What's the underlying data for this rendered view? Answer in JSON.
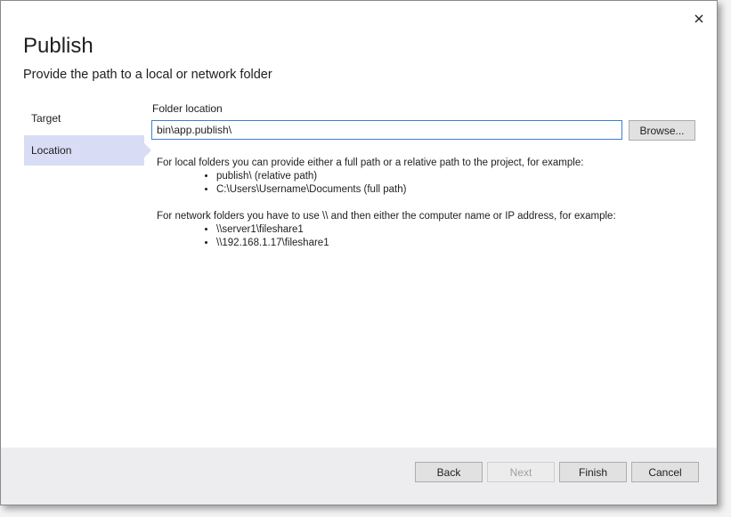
{
  "dialog": {
    "title": "Publish",
    "subtitle": "Provide the path to a local or network folder"
  },
  "nav": {
    "items": [
      {
        "label": "Target",
        "selected": false
      },
      {
        "label": "Location",
        "selected": true
      }
    ]
  },
  "location": {
    "field_label": "Folder location",
    "path_value": "bin\\app.publish\\",
    "browse_label": "Browse..."
  },
  "help": {
    "local_intro": "For local folders you can provide either a full path or a relative path to the project, for example:",
    "local_examples": [
      "publish\\ (relative path)",
      "C:\\Users\\Username\\Documents (full path)"
    ],
    "network_intro": "For network folders you have to use \\\\ and then either the computer name or IP address, for example:",
    "network_examples": [
      "\\\\server1\\fileshare1",
      "\\\\192.168.1.17\\fileshare1"
    ]
  },
  "footer": {
    "back_label": "Back",
    "next_label": "Next",
    "finish_label": "Finish",
    "cancel_label": "Cancel"
  },
  "colors": {
    "nav_selected_bg": "#d9dcf5",
    "input_focus_border": "#3c7fd1",
    "footer_bg": "#ededf0"
  },
  "icons": {
    "close": "close-icon"
  }
}
